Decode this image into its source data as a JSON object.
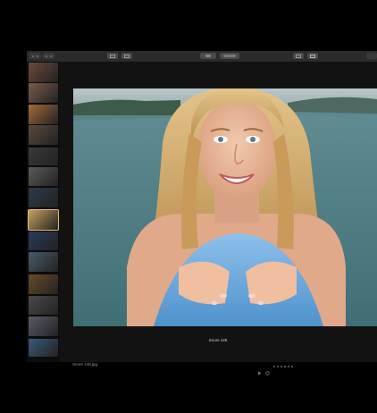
{
  "app": {
    "toolbar": {
      "left_buttons": [
        {
          "icon": "sidebar-toggle-icon"
        },
        {
          "icon": "grid-view-icon"
        }
      ],
      "center_buttons": [
        {
          "icon": "zoom-icon"
        },
        {
          "icon": "rotate-icon"
        }
      ],
      "right_buttons": [
        {
          "icon": "info-icon"
        },
        {
          "icon": "share-icon"
        }
      ]
    },
    "photo": {
      "caption": "Snore 426",
      "filename": "Snore 148.jpg",
      "accent": "#e8b96a"
    },
    "playback": {
      "icons": [
        "play-icon",
        "loop-icon"
      ],
      "page_count": 6
    },
    "sidebar": {
      "thumbnails": [
        {
          "label": "",
          "color": "#6b4a3a",
          "selected": false
        },
        {
          "label": "",
          "color": "#7a5a4a",
          "selected": false
        },
        {
          "label": "",
          "color": "#a26a3a",
          "selected": false
        },
        {
          "label": "",
          "color": "#5a4a3a",
          "selected": false
        },
        {
          "label": "",
          "color": "#3a3a3a",
          "selected": false
        },
        {
          "label": "",
          "color": "#5a5a5a",
          "selected": false
        },
        {
          "label": "",
          "color": "#2d3a4a",
          "selected": false
        },
        {
          "label": "",
          "color": "#c8a060",
          "selected": true
        },
        {
          "label": "",
          "color": "#2a3a5a",
          "selected": false
        },
        {
          "label": "",
          "color": "#4a5a6a",
          "selected": false
        },
        {
          "label": "",
          "color": "#6a4a2a",
          "selected": false
        },
        {
          "label": "",
          "color": "#4a4a4a",
          "selected": false
        },
        {
          "label": "",
          "color": "#5a5a6a",
          "selected": false
        },
        {
          "label": "",
          "color": "#3a5a7a",
          "selected": false
        }
      ]
    }
  }
}
